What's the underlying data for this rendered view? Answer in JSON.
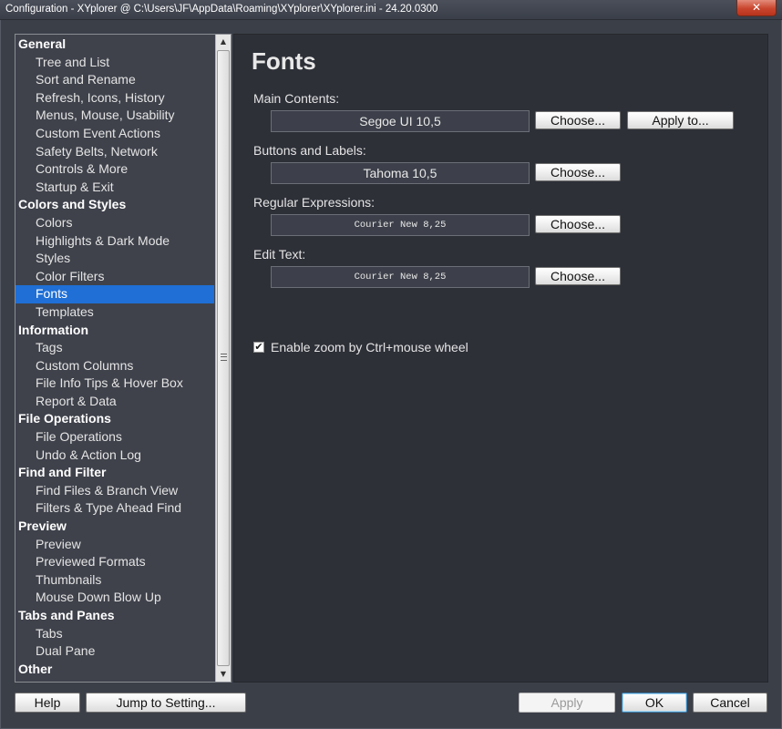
{
  "window": {
    "title": "Configuration - XYplorer @ C:\\Users\\JF\\AppData\\Roaming\\XYplorer\\XYplorer.ini - 24.20.0300",
    "close_label": "✕"
  },
  "tree": {
    "items": [
      {
        "label": "General",
        "type": "category"
      },
      {
        "label": "Tree and List",
        "type": "item"
      },
      {
        "label": "Sort and Rename",
        "type": "item"
      },
      {
        "label": "Refresh, Icons, History",
        "type": "item"
      },
      {
        "label": "Menus, Mouse, Usability",
        "type": "item"
      },
      {
        "label": "Custom Event Actions",
        "type": "item"
      },
      {
        "label": "Safety Belts, Network",
        "type": "item"
      },
      {
        "label": "Controls & More",
        "type": "item"
      },
      {
        "label": "Startup & Exit",
        "type": "item"
      },
      {
        "label": "Colors and Styles",
        "type": "category"
      },
      {
        "label": "Colors",
        "type": "item"
      },
      {
        "label": "Highlights & Dark Mode",
        "type": "item"
      },
      {
        "label": "Styles",
        "type": "item"
      },
      {
        "label": "Color Filters",
        "type": "item"
      },
      {
        "label": "Fonts",
        "type": "item",
        "selected": true
      },
      {
        "label": "Templates",
        "type": "item"
      },
      {
        "label": "Information",
        "type": "category"
      },
      {
        "label": "Tags",
        "type": "item"
      },
      {
        "label": "Custom Columns",
        "type": "item"
      },
      {
        "label": "File Info Tips & Hover Box",
        "type": "item"
      },
      {
        "label": "Report & Data",
        "type": "item"
      },
      {
        "label": "File Operations",
        "type": "category"
      },
      {
        "label": "File Operations",
        "type": "item"
      },
      {
        "label": "Undo & Action Log",
        "type": "item"
      },
      {
        "label": "Find and Filter",
        "type": "category"
      },
      {
        "label": "Find Files & Branch View",
        "type": "item"
      },
      {
        "label": "Filters & Type Ahead Find",
        "type": "item"
      },
      {
        "label": "Preview",
        "type": "category"
      },
      {
        "label": "Preview",
        "type": "item"
      },
      {
        "label": "Previewed Formats",
        "type": "item"
      },
      {
        "label": "Thumbnails",
        "type": "item"
      },
      {
        "label": "Mouse Down Blow Up",
        "type": "item"
      },
      {
        "label": "Tabs and Panes",
        "type": "category"
      },
      {
        "label": "Tabs",
        "type": "item"
      },
      {
        "label": "Dual Pane",
        "type": "item"
      },
      {
        "label": "Other",
        "type": "category"
      }
    ]
  },
  "main": {
    "title": "Fonts",
    "main_contents": {
      "label": "Main Contents:",
      "value": "Segoe UI 10,5",
      "choose": "Choose...",
      "apply_to": "Apply to..."
    },
    "buttons_labels": {
      "label": "Buttons and Labels:",
      "value": "Tahoma 10,5",
      "choose": "Choose..."
    },
    "regex": {
      "label": "Regular Expressions:",
      "value": "Courier New 8,25",
      "choose": "Choose..."
    },
    "edit_text": {
      "label": "Edit Text:",
      "value": "Courier New 8,25",
      "choose": "Choose..."
    },
    "zoom_checkbox": {
      "label": "Enable zoom by Ctrl+mouse wheel",
      "checked": true,
      "mark": "✔"
    }
  },
  "footer": {
    "help": "Help",
    "jump": "Jump to Setting...",
    "apply": "Apply",
    "ok": "OK",
    "cancel": "Cancel"
  },
  "icons": {
    "scroll_up": "▲",
    "scroll_down": "▼"
  }
}
